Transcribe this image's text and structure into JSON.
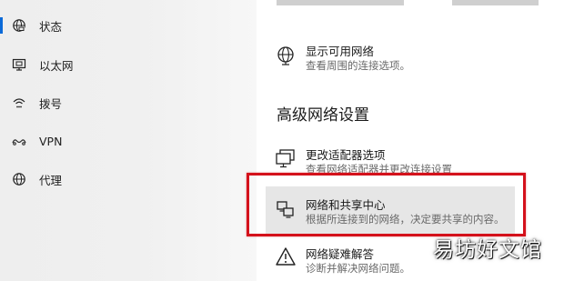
{
  "sidebar": {
    "items": [
      {
        "label": "状态",
        "icon": "status-globe-icon",
        "active": true
      },
      {
        "label": "以太网",
        "icon": "ethernet-icon",
        "active": false
      },
      {
        "label": "拨号",
        "icon": "dialup-icon",
        "active": false
      },
      {
        "label": "VPN",
        "icon": "vpn-icon",
        "active": false
      },
      {
        "label": "代理",
        "icon": "proxy-globe-icon",
        "active": false
      }
    ]
  },
  "main": {
    "show_networks": {
      "title": "显示可用网络",
      "subtitle": "查看周围的连接选项。",
      "icon": "globe-network-icon"
    },
    "advanced_section_title": "高级网络设置",
    "options": [
      {
        "title": "更改适配器选项",
        "subtitle": "查看网络适配器并更改连接设置",
        "icon": "adapter-monitor-icon"
      },
      {
        "title": "网络和共享中心",
        "subtitle": "根据所连接到的网络，决定要共享的内容。",
        "icon": "sharing-center-icon",
        "highlighted": true
      },
      {
        "title": "网络疑难解答",
        "subtitle": "诊断并解决网络问题。",
        "icon": "warning-triangle-icon"
      }
    ]
  },
  "colors": {
    "accent": "#0b6ad8",
    "highlight_border": "#d4111b",
    "hover_bg": "#e6e6e6"
  },
  "watermark": "易坊好文馆"
}
